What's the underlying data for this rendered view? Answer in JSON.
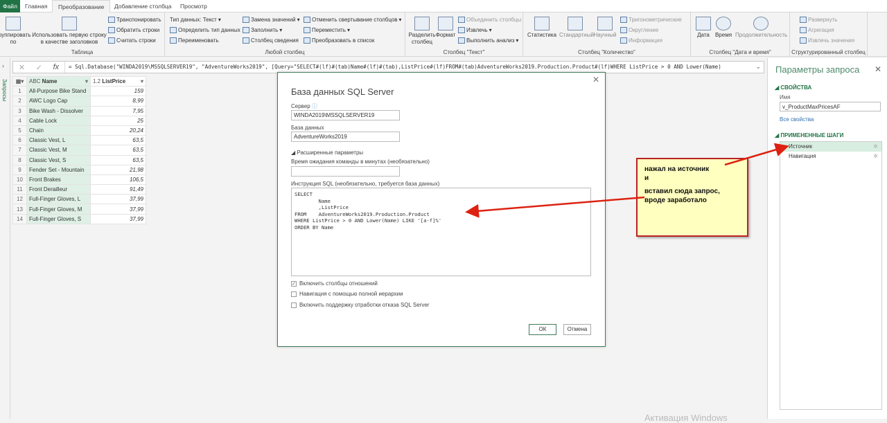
{
  "tabs": [
    "Файл",
    "Главная",
    "Преобразование",
    "Добавление столбца",
    "Просмотр"
  ],
  "ribbon": {
    "table": {
      "label": "Таблица",
      "group": "Группировать по",
      "first_row": "Использовать первую строку в качестве заголовков",
      "transpose": "Транспонировать",
      "reverse": "Обратить строки",
      "count": "Считать строки"
    },
    "any": {
      "label": "Любой столбец",
      "dtype": "Тип данных: Текст",
      "detect": "Определить тип данных",
      "rename": "Переименовать",
      "replace": "Замена значений",
      "fill": "Заполнить",
      "pivot": "Столбец сведения",
      "unpivot": "Отменить свертывание столбцов",
      "move": "Переместить",
      "tolist": "Преобразовать в список"
    },
    "text": {
      "label": "Столбец \"Текст\"",
      "split": "Разделить столбец",
      "format": "Формат",
      "merge": "Объединить столбцы",
      "extract": "Извлечь",
      "parse": "Выполнить анализ"
    },
    "number": {
      "label": "Столбец \"Количество\"",
      "stats": "Статистика",
      "standard": "Стандартный",
      "sci": "Научный",
      "trig": "Тригонометрические",
      "round": "Округление",
      "info": "Информация"
    },
    "date": {
      "label": "Столбец \"Дата и время\"",
      "date": "Дата",
      "time": "Время",
      "duration": "Продолжительность"
    },
    "struct": {
      "label": "Структурированный столбец",
      "expand": "Развернуть",
      "agg": "Агрегация",
      "extract": "Извлечь значения"
    }
  },
  "formula": "= Sql.Database(\"WINDA2019\\MSSQLSERVER19\", \"AdventureWorks2019\", [Query=\"SELECT#(lf)#(tab)Name#(lf)#(tab),ListPrice#(lf)FROM#(tab)AdventureWorks2019.Production.Product#(lf)WHERE ListPrice > 0 AND Lower(Name)",
  "queries_label": "Запросы",
  "grid": {
    "col_name": "Name",
    "col_price": "ListPrice",
    "rows": [
      [
        "1",
        "All-Purpose Bike Stand",
        "159"
      ],
      [
        "2",
        "AWC Logo Cap",
        "8,99"
      ],
      [
        "3",
        "Bike Wash - Dissolver",
        "7,95"
      ],
      [
        "4",
        "Cable Lock",
        "25"
      ],
      [
        "5",
        "Chain",
        "20,24"
      ],
      [
        "6",
        "Classic Vest, L",
        "63,5"
      ],
      [
        "7",
        "Classic Vest, M",
        "63,5"
      ],
      [
        "8",
        "Classic Vest, S",
        "63,5"
      ],
      [
        "9",
        "Fender Set - Mountain",
        "21,98"
      ],
      [
        "10",
        "Front Brakes",
        "106,5"
      ],
      [
        "11",
        "Front Derailleur",
        "91,49"
      ],
      [
        "12",
        "Full-Finger Gloves, L",
        "37,99"
      ],
      [
        "13",
        "Full-Finger Gloves, M",
        "37,99"
      ],
      [
        "14",
        "Full-Finger Gloves, S",
        "37,99"
      ]
    ]
  },
  "dialog": {
    "title": "База данных SQL Server",
    "server_label": "Сервер",
    "server": "WINDA2019\\MSSQLSERVER19",
    "db_label": "База данных",
    "db": "AdventureWorks2019",
    "advanced": "Расширенные параметры",
    "timeout_label": "Время ожидания команды в минутах (необязательно)",
    "sql_label": "Инструкция SQL (необязательно, требуется база данных)",
    "sql": "SELECT\n        Name\n        ,ListPrice\nFROM    AdventureWorks2019.Production.Product\nWHERE ListPrice > 0 AND Lower(Name) LIKE '[a-f]%'\nORDER BY Name",
    "cb1": "Включить столбцы отношений",
    "cb1_checked": true,
    "cb2": "Навигация с помощью полной иерархии",
    "cb3": "Включить поддержку отработки отказа SQL Server",
    "ok": "ОК",
    "cancel": "Отмена"
  },
  "pane": {
    "title": "Параметры запроса",
    "props": "СВОЙСТВА",
    "name_label": "Имя",
    "name": "v_ProductMaxPricesAF",
    "all_props": "Все свойства",
    "steps_label": "ПРИМЕНЕННЫЕ ШАГИ",
    "steps": [
      "Источник",
      "Навигация"
    ]
  },
  "note": {
    "l1": "нажал на источник",
    "l2": "и",
    "l3": "вставил сюда запрос,",
    "l4": "вроде заработало"
  },
  "watermark": "Активация Windows"
}
